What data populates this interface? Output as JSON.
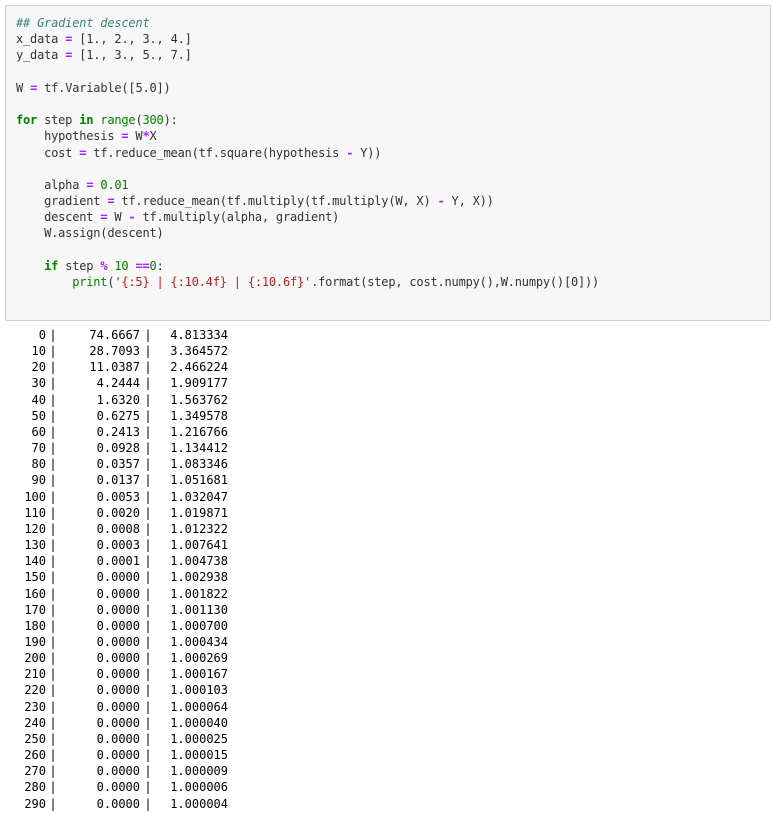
{
  "code_cell": {
    "lines": [
      [
        {
          "t": "## Gradient descent",
          "c": "cm"
        }
      ],
      [
        {
          "t": "x_data "
        },
        {
          "t": "=",
          "c": "op"
        },
        {
          "t": " [1., 2., 3., 4.]"
        }
      ],
      [
        {
          "t": "y_data "
        },
        {
          "t": "=",
          "c": "op"
        },
        {
          "t": " [1., 3., 5., 7.]"
        }
      ],
      [
        {
          "t": ""
        }
      ],
      [
        {
          "t": "W "
        },
        {
          "t": "=",
          "c": "op"
        },
        {
          "t": " tf"
        },
        {
          "t": "."
        },
        {
          "t": "Variable([5.0])"
        }
      ],
      [
        {
          "t": ""
        }
      ],
      [
        {
          "t": "for",
          "c": "kw"
        },
        {
          "t": " step "
        },
        {
          "t": "in",
          "c": "kw"
        },
        {
          "t": " "
        },
        {
          "t": "range",
          "c": "bi"
        },
        {
          "t": "("
        },
        {
          "t": "300",
          "c": "nu"
        },
        {
          "t": "):"
        }
      ],
      [
        {
          "t": "    hypothesis "
        },
        {
          "t": "=",
          "c": "op"
        },
        {
          "t": " W"
        },
        {
          "t": "*",
          "c": "op"
        },
        {
          "t": "X"
        }
      ],
      [
        {
          "t": "    cost "
        },
        {
          "t": "=",
          "c": "op"
        },
        {
          "t": " tf.reduce_mean(tf.square(hypothesis "
        },
        {
          "t": "-",
          "c": "op"
        },
        {
          "t": " Y))"
        }
      ],
      [
        {
          "t": ""
        }
      ],
      [
        {
          "t": "    alpha "
        },
        {
          "t": "=",
          "c": "op"
        },
        {
          "t": " "
        },
        {
          "t": "0.01",
          "c": "nu"
        }
      ],
      [
        {
          "t": "    gradient "
        },
        {
          "t": "=",
          "c": "op"
        },
        {
          "t": " tf.reduce_mean(tf.multiply(tf.multiply(W, X) "
        },
        {
          "t": "-",
          "c": "op"
        },
        {
          "t": " Y, X))"
        }
      ],
      [
        {
          "t": "    descent "
        },
        {
          "t": "=",
          "c": "op"
        },
        {
          "t": " W "
        },
        {
          "t": "-",
          "c": "op"
        },
        {
          "t": " tf.multiply(alpha, gradient)"
        }
      ],
      [
        {
          "t": "    W.assign(descent)"
        }
      ],
      [
        {
          "t": ""
        }
      ],
      [
        {
          "t": "    "
        },
        {
          "t": "if",
          "c": "kw"
        },
        {
          "t": " step "
        },
        {
          "t": "%",
          "c": "op"
        },
        {
          "t": " "
        },
        {
          "t": "10",
          "c": "nu"
        },
        {
          "t": " "
        },
        {
          "t": "==",
          "c": "op"
        },
        {
          "t": "0",
          "c": "nu"
        },
        {
          "t": ":"
        }
      ],
      [
        {
          "t": "        "
        },
        {
          "t": "print",
          "c": "bi"
        },
        {
          "t": "("
        },
        {
          "t": "'{:5} | {:10.4f} | {:10.6f}'",
          "c": "st"
        },
        {
          "t": ".format(step, cost.numpy(),W.numpy()[0]))"
        }
      ]
    ]
  },
  "output": {
    "separator": "|",
    "rows": [
      {
        "step": "0",
        "cost": "74.6667",
        "w": "4.813334"
      },
      {
        "step": "10",
        "cost": "28.7093",
        "w": "3.364572"
      },
      {
        "step": "20",
        "cost": "11.0387",
        "w": "2.466224"
      },
      {
        "step": "30",
        "cost": "4.2444",
        "w": "1.909177"
      },
      {
        "step": "40",
        "cost": "1.6320",
        "w": "1.563762"
      },
      {
        "step": "50",
        "cost": "0.6275",
        "w": "1.349578"
      },
      {
        "step": "60",
        "cost": "0.2413",
        "w": "1.216766"
      },
      {
        "step": "70",
        "cost": "0.0928",
        "w": "1.134412"
      },
      {
        "step": "80",
        "cost": "0.0357",
        "w": "1.083346"
      },
      {
        "step": "90",
        "cost": "0.0137",
        "w": "1.051681"
      },
      {
        "step": "100",
        "cost": "0.0053",
        "w": "1.032047"
      },
      {
        "step": "110",
        "cost": "0.0020",
        "w": "1.019871"
      },
      {
        "step": "120",
        "cost": "0.0008",
        "w": "1.012322"
      },
      {
        "step": "130",
        "cost": "0.0003",
        "w": "1.007641"
      },
      {
        "step": "140",
        "cost": "0.0001",
        "w": "1.004738"
      },
      {
        "step": "150",
        "cost": "0.0000",
        "w": "1.002938"
      },
      {
        "step": "160",
        "cost": "0.0000",
        "w": "1.001822"
      },
      {
        "step": "170",
        "cost": "0.0000",
        "w": "1.001130"
      },
      {
        "step": "180",
        "cost": "0.0000",
        "w": "1.000700"
      },
      {
        "step": "190",
        "cost": "0.0000",
        "w": "1.000434"
      },
      {
        "step": "200",
        "cost": "0.0000",
        "w": "1.000269"
      },
      {
        "step": "210",
        "cost": "0.0000",
        "w": "1.000167"
      },
      {
        "step": "220",
        "cost": "0.0000",
        "w": "1.000103"
      },
      {
        "step": "230",
        "cost": "0.0000",
        "w": "1.000064"
      },
      {
        "step": "240",
        "cost": "0.0000",
        "w": "1.000040"
      },
      {
        "step": "250",
        "cost": "0.0000",
        "w": "1.000025"
      },
      {
        "step": "260",
        "cost": "0.0000",
        "w": "1.000015"
      },
      {
        "step": "270",
        "cost": "0.0000",
        "w": "1.000009"
      },
      {
        "step": "280",
        "cost": "0.0000",
        "w": "1.000006"
      },
      {
        "step": "290",
        "cost": "0.0000",
        "w": "1.000004"
      }
    ]
  }
}
